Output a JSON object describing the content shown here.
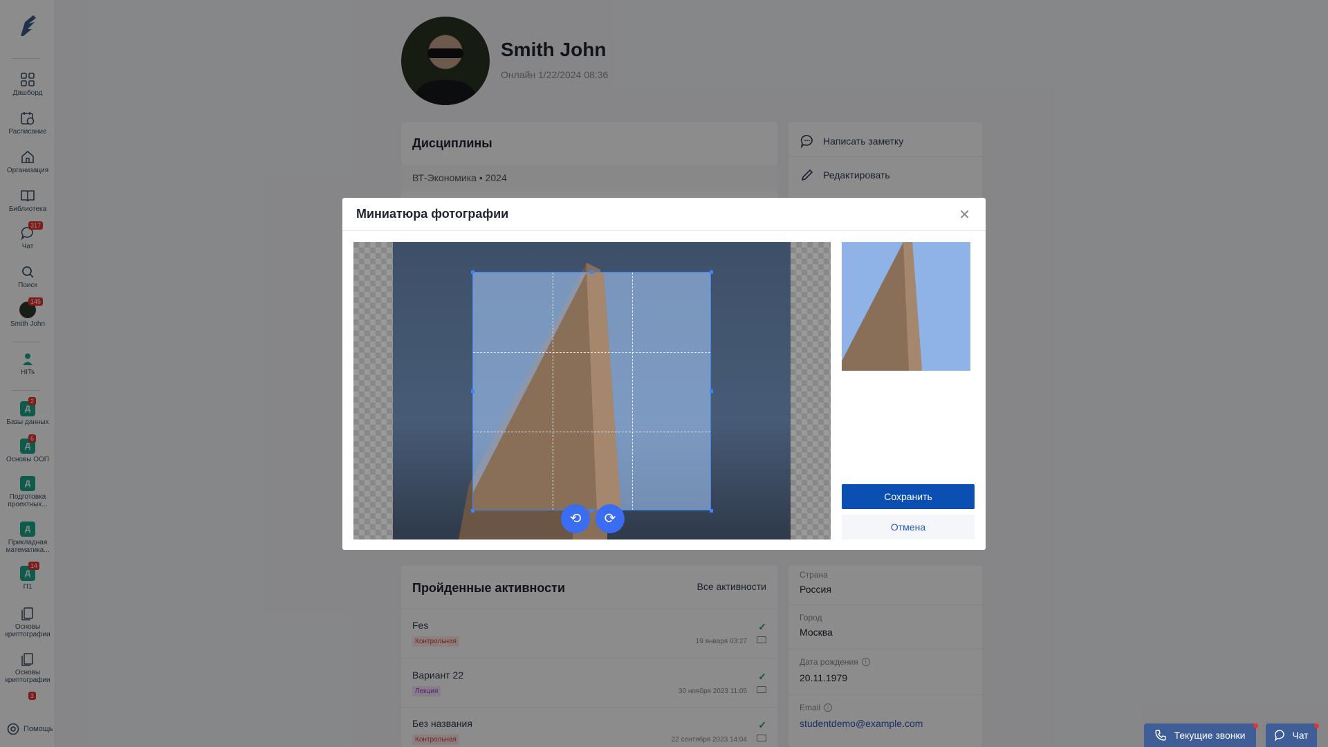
{
  "sidebar": {
    "items": [
      {
        "label": "Дашборд",
        "icon": "grid-icon"
      },
      {
        "label": "Расписание",
        "icon": "calendar-clock-icon"
      },
      {
        "label": "Организация",
        "icon": "home-icon"
      },
      {
        "label": "Библиотека",
        "icon": "book-icon"
      },
      {
        "label": "Чат",
        "icon": "chat-icon",
        "badge": "317"
      },
      {
        "label": "Поиск",
        "icon": "search-icon"
      },
      {
        "label": "Smith John",
        "icon": "avatar",
        "badge": "145"
      },
      {
        "label": "HITs",
        "icon": "mascot-icon"
      },
      {
        "label": "Базы данных",
        "tile": "Д",
        "badge": "2"
      },
      {
        "label": "Основы ООП",
        "tile": "Д",
        "badge": "6"
      },
      {
        "label_1": "Подготовка",
        "label_2": "проектных...",
        "tile": "Д"
      },
      {
        "label_1": "Прикладная",
        "label_2": "математика...",
        "tile": "Д"
      },
      {
        "label": "П1",
        "tile": "Д",
        "badge": "14"
      },
      {
        "label_1": "Основы",
        "label_2": "криптографии",
        "icon": "doc-stack-icon"
      },
      {
        "label_1": "Основы",
        "label_2": "криптографии",
        "icon": "doc-stack-icon"
      },
      {
        "badge": "3"
      }
    ],
    "help_label": "Помощь"
  },
  "profile": {
    "name": "Smith John",
    "status": "Онлайн 1/22/2024 08:36"
  },
  "disciplines": {
    "title": "Дисциплины",
    "first_row": "ВТ-Экономика • 2024"
  },
  "actions": {
    "write_note": "Написать заметку",
    "edit": "Редактировать"
  },
  "activities": {
    "title": "Пройденные активности",
    "all_link": "Все активности",
    "items": [
      {
        "name": "Fes",
        "tag": "Контрольная",
        "date": "19 января 03:27"
      },
      {
        "name": "Вариант 22",
        "tag": "Лекция",
        "date": "30 ноября 2023 11:05"
      },
      {
        "name": "Без названия",
        "tag": "Контрольная",
        "date": "22 сентября 2023 14:04"
      }
    ]
  },
  "info": {
    "country_label": "Страна",
    "country": "Россия",
    "city_label": "Город",
    "city": "Москва",
    "birth_label": "Дата рождения",
    "birth": "20.11.1979",
    "email_label": "Email",
    "email": "studentdemo@example.com"
  },
  "floating": {
    "calls": "Текущие звонки",
    "chat": "Чат"
  },
  "modal": {
    "title": "Миниатюра фотографии",
    "save": "Сохранить",
    "cancel": "Отмена"
  },
  "colors": {
    "accent": "#0b4fb3",
    "tile": "#1aa68a",
    "badge": "#e3342f"
  }
}
